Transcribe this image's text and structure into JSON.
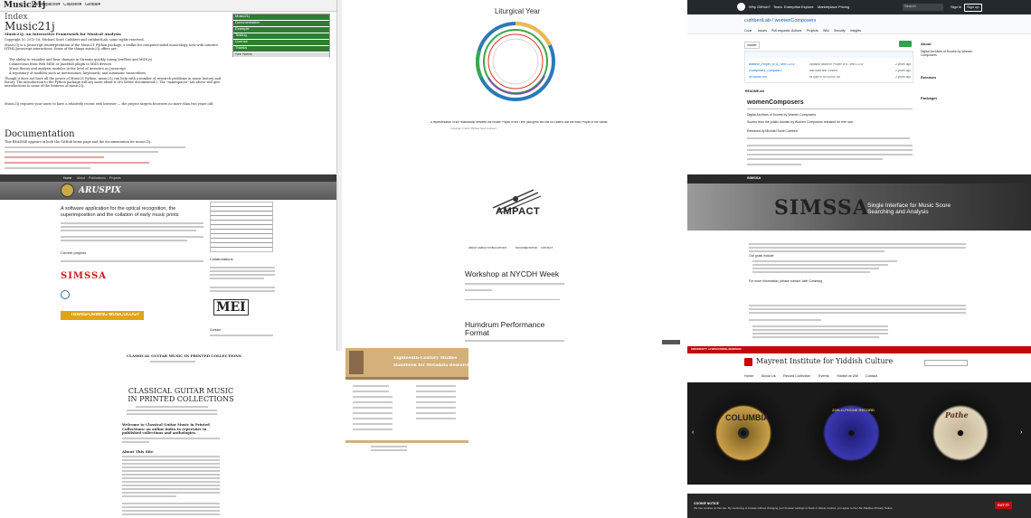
{
  "music21j": {
    "logo": "Music21j",
    "nav": [
      "Namespaces▾",
      "Classes▾",
      "Global▾"
    ],
    "index_title": "Index",
    "title": "Music21j",
    "subtitle": "Music21j: An Interactive Framework for Musical Analysis",
    "copyright": "Copyright (c) 2013-18, Michael Scott Cuthbert and cuthbertLab, some rights reserved.",
    "intro": "Music21j is a Javascript reinterpretation of the Music21 Python package, a toolkit for computer-aided musicology, now with intuitive HTML/Javascript interactions. Some of the things music21j offers are:",
    "bullets": [
      "The ability to visualize and hear changes in Streams quickly (using VexFlow and MIDI.js)",
      "Connections from Web MIDI or JazzMidi plugin to MIDI devices",
      "Music theory and analysis modules in the level of inventive as Javascript",
      "A repository of modules such as metronomes, keyboards, and automatic transcribers"
    ],
    "para2": "Though it does not have all the power of Music21 Python, music21j can help with a number of research problems in music history and theory. The introduction to the Python package will say more about it (it's better documented!). The \"namespaces\" tab above will give introductions to some of the features of music21j.",
    "para3": "Music21j requires your users to have a relatively recent web browser — the project targets browsers no more than two years old.",
    "doc_title": "Documentation",
    "doc_text": "This README appears in both the GitHub home page and the documentation for music21j.",
    "sidebar": [
      "Music21j",
      "Documentation",
      "Example",
      "Testing",
      "License",
      "Thanks",
      "See Notes"
    ]
  },
  "liturgical": {
    "title": "Liturgical Year",
    "caption": "A representation of the relationship between the mobile Proper of the Time (along the red line for Easter) and the fixed Proper of the Saints.",
    "copyright": "Copyright © 2017 Michael Scott Cuthbert"
  },
  "github": {
    "topnav": [
      "Why GitHub?",
      "Team",
      "Enterprise",
      "Explore",
      "Marketplace",
      "Pricing"
    ],
    "search": "Search",
    "signin": "Sign in",
    "signup": "Sign up",
    "repo": "cuthbertLab / womenComposers",
    "tabs": [
      "Code",
      "Issues",
      "Pull requests",
      "Actions",
      "Projects",
      "Wiki",
      "Security",
      "Insights"
    ],
    "branch": "master",
    "files": [
      {
        "name": "Bsearch_Proper_of_a_Time1.CSV",
        "msg": "updated Bsearch Proper of a Time1.CSV",
        "age": "2 years ago"
      },
      {
        "name": "Ecomposers_Complete.P",
        "msg": "add data and content",
        "age": "2 years ago"
      },
      {
        "name": "README.md",
        "msg": "fix type in README.md",
        "age": "2 years ago"
      }
    ],
    "about_title": "About",
    "about_text": "Digital Archives of Scores by Women Composers",
    "readme_label": "README.md",
    "readme_title": "womenComposers",
    "readme_sub": "Digital Archives of Scores by Women Composers",
    "readme_p1": "Scores from the public domain by Women Composers released for free use.",
    "readme_p2": "Released by Michael Scott Cuthbert",
    "releases": "Releases",
    "packages": "Packages"
  },
  "aruspix": {
    "nav": [
      "Home",
      "About",
      "Publications",
      "Projects"
    ],
    "logo": "ARUSPIX",
    "headline": "A software application for the optical recognition, the superimposition and the collation of early music prints",
    "current": "Current projects",
    "collab": "Collaborations",
    "simssa": "SIMSSA",
    "banner": "TRANSFORMING MUSICOLOGY",
    "mei": "MEI",
    "contact": "Contact"
  },
  "ampact": {
    "logo": "AMPACT",
    "nav": [
      "ABOUT AMPACT",
      "PUBLICATIONS",
      "DOCUMENTATION",
      "CONTACT"
    ],
    "post1": "Workshop at NYCDH Week",
    "post2": "Humdrum Performance Format"
  },
  "simssa": {
    "nav": "SIMSSA",
    "title": "SIMSSA",
    "subtitle": "Single Interface for Music Score Searching and Analysis",
    "goals": "Our goals include:",
    "more": "For more information, please contact Julie Cumming"
  },
  "guitar": {
    "header": "CLASSICAL GUITAR MUSIC IN PRINTED COLLECTIONS",
    "title": "CLASSICAL GUITAR MUSIC IN PRINTED COLLECTIONS",
    "welcome": "Welcome to Classical Guitar Music in Printed Collections: an online index to repertoire in published collections and anthologies.",
    "about": "About This Site"
  },
  "c18": {
    "title": "Eighteenth-Century Studies",
    "subtitle": "Handbook for Metadata Research"
  },
  "mayrent": {
    "univ": "UNIVERSITY of WISCONSIN–MADISON",
    "title": "Mayrent Institute for Yiddish Culture",
    "nav": [
      "Home",
      "About Us",
      "Record Collection",
      "Events",
      "Yiddish at UW",
      "Contact"
    ],
    "labels": [
      "COLUMBIA",
      "ZON-O-PHONE RECORD",
      "Pathe"
    ],
    "cookie_title": "COOKIE NOTICE",
    "cookie_text": "We use cookies on this site. By continuing to browse without changing your browser settings to block or delete cookies, you agree to the UW–Madison Privacy Notice.",
    "cookie_btn": "GOT IT!"
  },
  "colors": {
    "green": "#2e7d32",
    "simssa_gray": "#555",
    "aruspix_dark": "#3a3a3a",
    "mayrent_red": "#c5050c",
    "ampact_teal": "#1b6b7a"
  }
}
